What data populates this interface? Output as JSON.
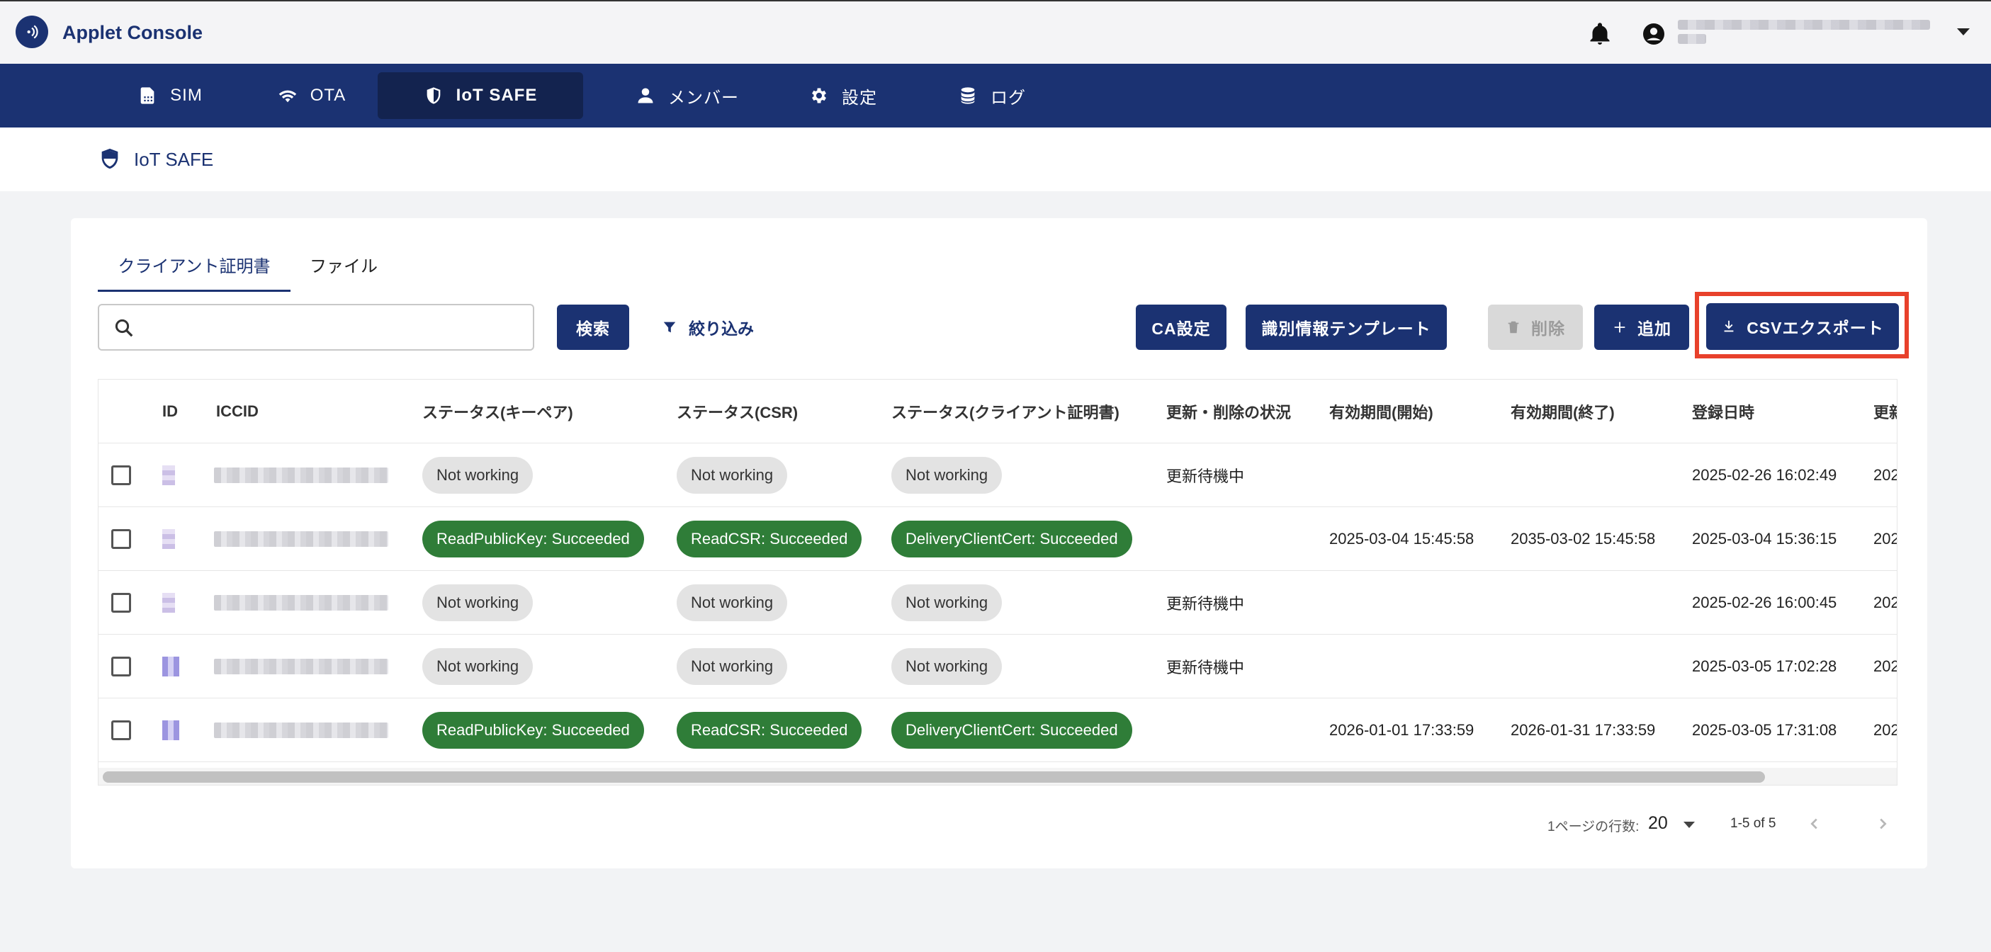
{
  "app": {
    "title": "Applet Console"
  },
  "nav": [
    {
      "label": "SIM",
      "icon": "sim-icon"
    },
    {
      "label": "OTA",
      "icon": "wifi-icon"
    },
    {
      "label": "IoT SAFE",
      "icon": "shield-icon",
      "active": true
    },
    {
      "label": "メンバー",
      "icon": "person-icon"
    },
    {
      "label": "設定",
      "icon": "gear-icon"
    },
    {
      "label": "ログ",
      "icon": "database-icon"
    }
  ],
  "breadcrumb": {
    "title": "IoT SAFE"
  },
  "tabs": [
    {
      "label": "クライアント証明書",
      "active": true
    },
    {
      "label": "ファイル"
    }
  ],
  "toolbar": {
    "search_value": "",
    "search_button": "検索",
    "filter_button": "絞り込み",
    "ca_button": "CA設定",
    "template_button": "識別情報テンプレート",
    "delete_button": "削除",
    "add_button": "追加",
    "csv_button": "CSVエクスポート"
  },
  "table": {
    "columns": [
      "ID",
      "ICCID",
      "ステータス(キーペア)",
      "ステータス(CSR)",
      "ステータス(クライアント証明書)",
      "更新・削除の状況",
      "有効期間(開始)",
      "有効期間(終了)",
      "登録日時",
      "更新"
    ],
    "rows": [
      {
        "keypair": "Not working",
        "csr": "Not working",
        "cert": "Not working",
        "state": "更新待機中",
        "start": "",
        "end": "",
        "registered": "2025-02-26 16:02:49",
        "updated": "202",
        "ok": false
      },
      {
        "keypair": "ReadPublicKey: Succeeded",
        "csr": "ReadCSR: Succeeded",
        "cert": "DeliveryClientCert: Succeeded",
        "state": "",
        "start": "2025-03-04 15:45:58",
        "end": "2035-03-02 15:45:58",
        "registered": "2025-03-04 15:36:15",
        "updated": "202",
        "ok": true
      },
      {
        "keypair": "Not working",
        "csr": "Not working",
        "cert": "Not working",
        "state": "更新待機中",
        "start": "",
        "end": "",
        "registered": "2025-02-26 16:00:45",
        "updated": "202",
        "ok": false
      },
      {
        "keypair": "Not working",
        "csr": "Not working",
        "cert": "Not working",
        "state": "更新待機中",
        "start": "",
        "end": "",
        "registered": "2025-03-05 17:02:28",
        "updated": "202",
        "ok": false
      },
      {
        "keypair": "ReadPublicKey: Succeeded",
        "csr": "ReadCSR: Succeeded",
        "cert": "DeliveryClientCert: Succeeded",
        "state": "",
        "start": "2026-01-01 17:33:59",
        "end": "2026-01-31 17:33:59",
        "registered": "2025-03-05 17:31:08",
        "updated": "202",
        "ok": true
      }
    ]
  },
  "pagination": {
    "rows_label": "1ページの行数:",
    "rows_value": "20",
    "range": "1-5 of 5"
  },
  "colors": {
    "primary": "#1b3272",
    "success": "#2f7d38",
    "highlight": "#e8412b"
  }
}
